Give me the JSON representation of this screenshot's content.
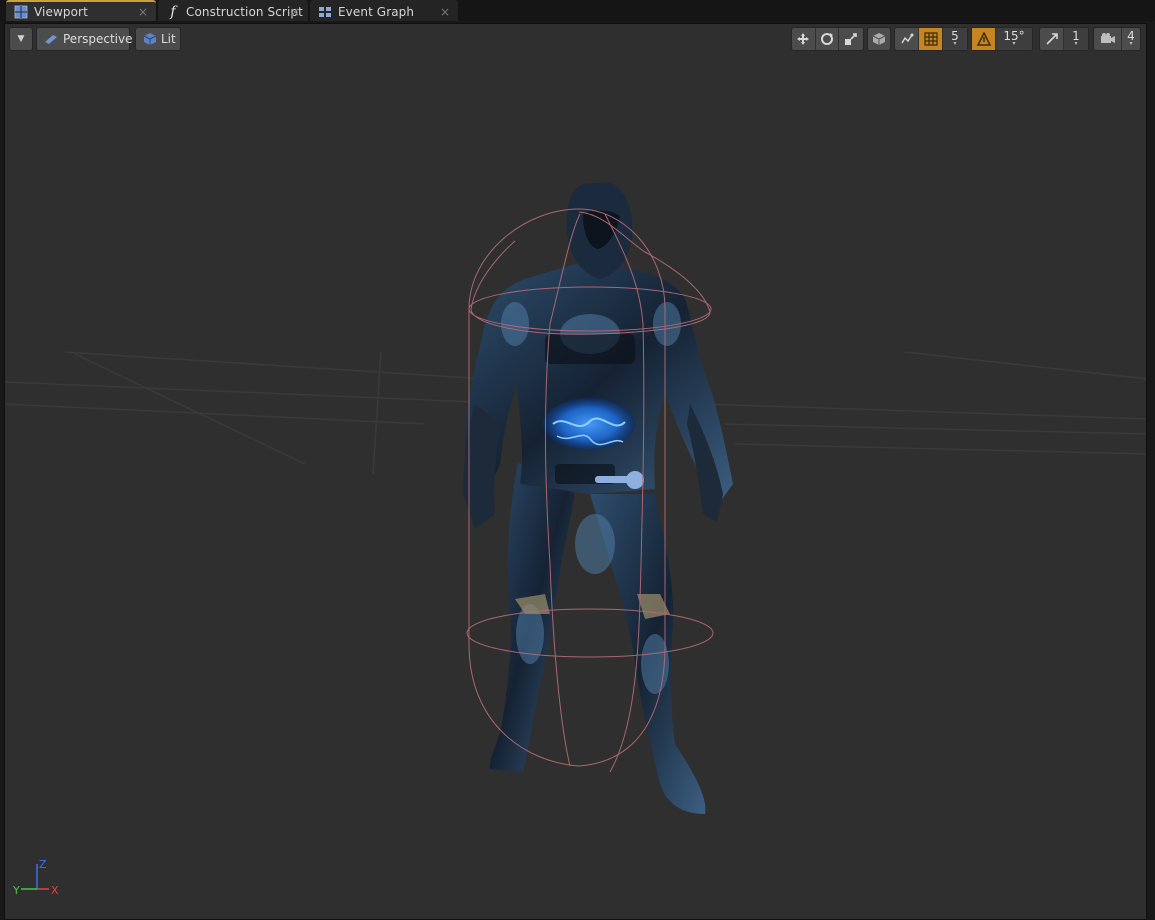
{
  "tabs": [
    {
      "label": "Viewport",
      "icon": "viewport-icon",
      "active": true
    },
    {
      "label": "Construction Script",
      "icon": "function-icon",
      "active": false
    },
    {
      "label": "Event Graph",
      "icon": "graph-icon",
      "active": false
    }
  ],
  "toolbar": {
    "view_mode_label": "Perspective",
    "lighting_label": "Lit",
    "grid_snap_value": "5",
    "rotation_snap_value": "15°",
    "scale_snap_value": "1",
    "camera_speed_value": "4"
  },
  "axis": {
    "x": "X",
    "y": "Y",
    "z": "Z"
  },
  "colors": {
    "accent": "#c9a23a",
    "snap_active": "#c78522",
    "viewport_bg": "#2f2f2f",
    "capsule": "#b06a76",
    "emissive": "#2b7fff"
  }
}
